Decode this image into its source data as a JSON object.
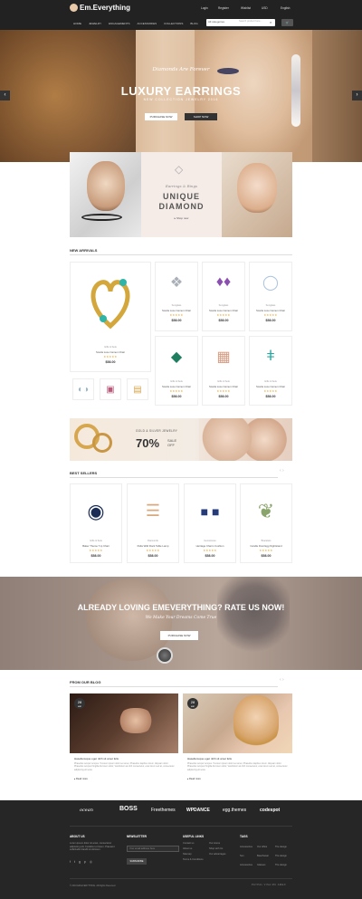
{
  "header": {
    "logo": "Em.Everything",
    "top_links": [
      "Login",
      "Register",
      "Wishlist",
      "USD",
      "English"
    ],
    "nav": [
      "HOME",
      "JEWELRY",
      "ENGAGEMENTS",
      "ACCESSORIES",
      "COLLECTIONS",
      "BLOG"
    ],
    "search": {
      "category": "All categories",
      "placeholder": "Search product here..."
    }
  },
  "hero": {
    "script": "Diamonds Are Forever",
    "title": "LUXURY EARRINGS",
    "subtitle": "NEW COLLECTION JEWELRY 2016",
    "btn_primary": "PURCHASE NOW",
    "btn_secondary": "SHOP NOW"
  },
  "promo": {
    "script": "Earrings & Rings",
    "title_line1": "UNIQUE",
    "title_line2": "DIAMOND",
    "link": "Shop now"
  },
  "new_arrivals": {
    "heading": "NEW ARRIVALS",
    "featured": {
      "category": "Gifts & Sets",
      "name": "Scarla Luxe Camen Chair",
      "stars": "★★★★★",
      "price": "$58.00"
    },
    "products": [
      {
        "category": "Sunglass",
        "name": "Scarla Luxe Camen Chair",
        "stars": "★★★★★",
        "price": "$58.00"
      },
      {
        "category": "Sunglass",
        "name": "Scarla Luxe Camen Chair",
        "stars": "★★★★★",
        "price": "$58.00"
      },
      {
        "category": "Sunglass",
        "name": "Scarla Luxe Camen Chair",
        "stars": "★★★★★",
        "price": "$58.00"
      },
      {
        "category": "Gifts & Sets",
        "name": "Scarla Luxe Camen Chair",
        "stars": "★★★★★",
        "price": "$58.00"
      },
      {
        "category": "Gifts & Sets",
        "name": "Scarla Luxe Camen Chair",
        "stars": "★★★★★",
        "price": "$58.00"
      },
      {
        "category": "Gifts & Sets",
        "name": "Scarla Luxe Camen Chair",
        "stars": "★★★★★",
        "price": "$58.00"
      }
    ]
  },
  "banner": {
    "small": "GOLD & SILVER JEWELRY",
    "big": "70%",
    "sale1": "SALE",
    "sale2": "OFF"
  },
  "best_sellers": {
    "heading": "BEST SELLERS",
    "products": [
      {
        "category": "Gifts & Sets",
        "name": "Baker Theme T-ip Chair",
        "stars": "★★★★★",
        "price": "$58.00"
      },
      {
        "category": "Diamonds",
        "name": "Pella Wild Rock Table Lamp",
        "stars": "★★★★★",
        "price": "$58.00"
      },
      {
        "category": "Gemstones",
        "name": "Heritage Charm Cushion",
        "stars": "★★★★★",
        "price": "$58.00"
      },
      {
        "category": "Bracelets",
        "name": "Candle Dust Egg Nightstand",
        "stars": "★★★★★",
        "price": "$58.00"
      }
    ]
  },
  "testimonial": {
    "title": "ALREADY LOVING EMEVERYTHING? RATE US NOW!",
    "subtitle": "We Make Your Dreams Come True",
    "button": "PURCHASE NOW"
  },
  "blog": {
    "heading": "FROM OUR BLOG",
    "posts": [
      {
        "day": "28",
        "month": "MAY",
        "title": "Hasellenuque eget nibh sit amet felis",
        "excerpt": "Phasellus tempor tempus. Tucorem ipsum dolor set amet, Phasellus dapibus lorem. Aliquam dolor. Phasellus tempus fringilla dis lorem dolor, Vestibulum at nibh consectetur, eras lorem sed at, consectetur adipiscing elit eras.",
        "more": "Read more"
      },
      {
        "day": "28",
        "month": "MAY",
        "title": "Hasellenuque eget nibh sit amet felis",
        "excerpt": "Phasellus tempor tempus. Tucorem ipsum dolor set amet, Phasellus dapibus lorem. Aliquam dolor. Phasellus tempus fringilla dis lorem dolor, Vestibulum at nibh consectetur, eras lorem sed at, consectetur adipiscing elit eras.",
        "more": "Read more"
      }
    ]
  },
  "brands": [
    "ocean",
    "BOSS",
    "Freethemes",
    "WPDANCE",
    "egg.themes",
    "codespot"
  ],
  "footer": {
    "about": {
      "heading": "ABOUT US",
      "text": "Lorem ipsum dolor sit amet, consectetur adipiscing elit. Curabitur et lorem. Praesent sollicitudin blandit sit dolorem."
    },
    "newsletter": {
      "heading": "NEWSLETTER",
      "placeholder": "Your email address here",
      "button": "SUBSCRIBE"
    },
    "useful": {
      "heading": "USEFUL LINKS",
      "col1": [
        "Contact us",
        "About us",
        "Sitemap",
        "Terms & Conditions"
      ],
      "col2": [
        "Our stores",
        "Shop with Us",
        "Our advantages"
      ]
    },
    "tags": {
      "heading": "TAGS",
      "col1": [
        "Accessories",
        "Sun",
        "Accessories"
      ],
      "col2": [
        "Our office",
        "Beachwear",
        "Glasses"
      ],
      "col3": [
        "The design",
        "The design",
        "The design"
      ]
    },
    "copyright": "© 2016 EM.EVERYTHING. All Rights Reserved.",
    "payments": "PAYPAL  VISA  MC  AMEX"
  },
  "colors": {
    "dark": "#222222",
    "accent_star": "#f0a62b",
    "promo_bg": "#f5ece8"
  }
}
